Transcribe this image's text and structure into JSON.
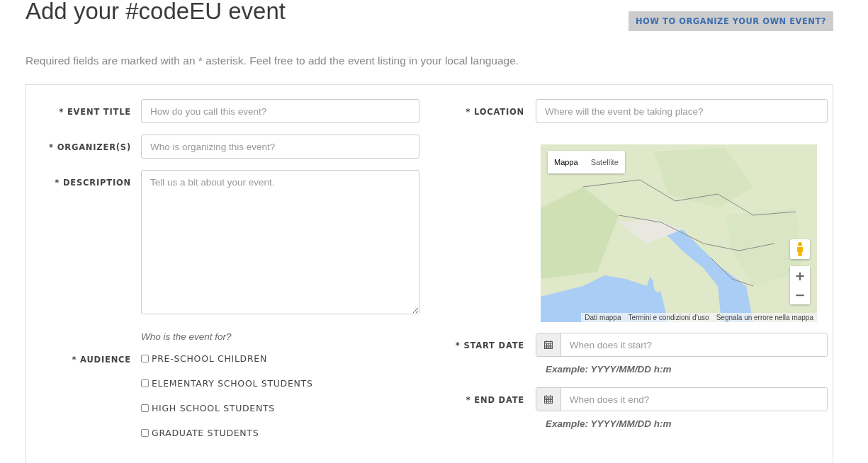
{
  "page": {
    "title": "Add your #codeEU event",
    "help_button": "HOW TO ORGANIZE YOUR OWN EVENT?",
    "intro": "Required fields are marked with an * asterisk. Feel free to add the event listing in your local language."
  },
  "left_fields": [
    {
      "kind": "text",
      "label": "* EVENT TITLE",
      "placeholder": "How do you call this event?"
    },
    {
      "kind": "text",
      "label": "* ORGANIZER(S)",
      "placeholder": "Who is organizing this event?"
    },
    {
      "kind": "textarea",
      "label": "* DESCRIPTION",
      "placeholder": "Tell us a bit about your event."
    }
  ],
  "audience": {
    "hint": "Who is the event for?",
    "label": "* AUDIENCE",
    "options": [
      {
        "label": "PRE-SCHOOL CHILDREN",
        "checked": false
      },
      {
        "label": "ELEMENTARY SCHOOL STUDENTS",
        "checked": false
      },
      {
        "label": "HIGH SCHOOL STUDENTS",
        "checked": false
      },
      {
        "label": "GRADUATE STUDENTS",
        "checked": false
      }
    ]
  },
  "location": {
    "label": "* LOCATION",
    "placeholder": "Where will the event be taking place?"
  },
  "map": {
    "kind": "picture",
    "types": [
      {
        "label": "Mappa",
        "selected": true
      },
      {
        "label": "Satellite",
        "selected": false
      }
    ],
    "zoom_in": "+",
    "zoom_out": "−",
    "footer": [
      "Dati mappa",
      "Termini e condizioni d'uso",
      "Segnala un errore nella mappa"
    ]
  },
  "dates": [
    {
      "label": "* START DATE",
      "placeholder": "When does it start?",
      "example": "Example: YYYY/MM/DD h:m"
    },
    {
      "label": "* END DATE",
      "placeholder": "When does it end?",
      "example": "Example: YYYY/MM/DD h:m"
    }
  ]
}
